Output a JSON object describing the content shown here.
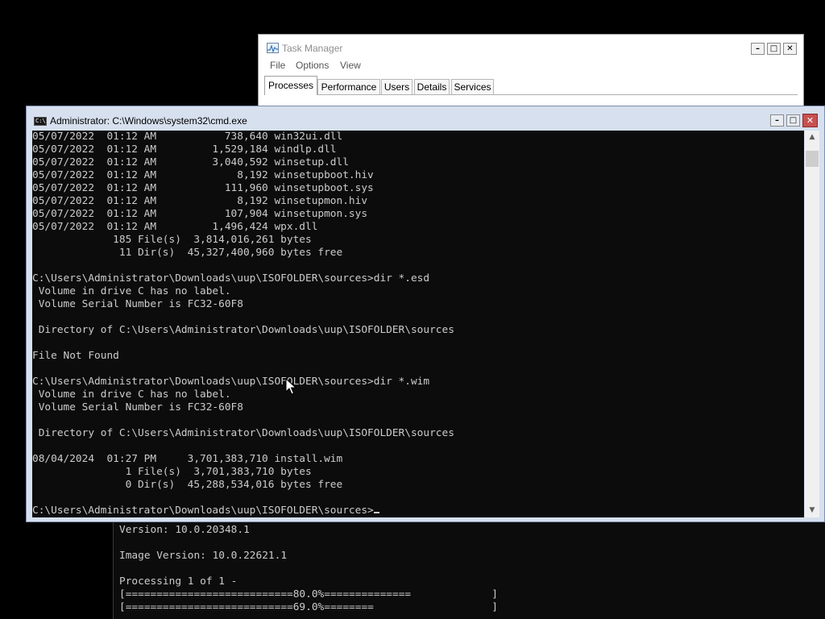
{
  "background_console": {
    "lines": [
      "Version: 10.0.20348.1",
      "",
      "Image Version: 10.0.22621.1",
      "",
      "Processing 1 of 1 -",
      "[===========================80.0%==============             ]",
      "[===========================69.0%========                   ]"
    ]
  },
  "task_manager": {
    "title": "Task Manager",
    "menu": [
      "File",
      "Options",
      "View"
    ],
    "tabs": [
      "Processes",
      "Performance",
      "Users",
      "Details",
      "Services"
    ],
    "active_tab": "Processes",
    "buttons": {
      "minimize": "–",
      "maximize": "□",
      "close": "✕"
    }
  },
  "cmd_window": {
    "title": "Administrator: C:\\Windows\\system32\\cmd.exe",
    "icon_text": "C:\\",
    "buttons": {
      "minimize": "–",
      "maximize": "□",
      "close": "✕"
    },
    "lines": [
      "05/07/2022  01:12 AM           738,640 win32ui.dll",
      "05/07/2022  01:12 AM         1,529,184 windlp.dll",
      "05/07/2022  01:12 AM         3,040,592 winsetup.dll",
      "05/07/2022  01:12 AM             8,192 winsetupboot.hiv",
      "05/07/2022  01:12 AM           111,960 winsetupboot.sys",
      "05/07/2022  01:12 AM             8,192 winsetupmon.hiv",
      "05/07/2022  01:12 AM           107,904 winsetupmon.sys",
      "05/07/2022  01:12 AM         1,496,424 wpx.dll",
      "             185 File(s)  3,814,016,261 bytes",
      "              11 Dir(s)  45,327,400,960 bytes free",
      "",
      "C:\\Users\\Administrator\\Downloads\\uup\\ISOFOLDER\\sources>dir *.esd",
      " Volume in drive C has no label.",
      " Volume Serial Number is FC32-60F8",
      "",
      " Directory of C:\\Users\\Administrator\\Downloads\\uup\\ISOFOLDER\\sources",
      "",
      "File Not Found",
      "",
      "C:\\Users\\Administrator\\Downloads\\uup\\ISOFOLDER\\sources>dir *.wim",
      " Volume in drive C has no label.",
      " Volume Serial Number is FC32-60F8",
      "",
      " Directory of C:\\Users\\Administrator\\Downloads\\uup\\ISOFOLDER\\sources",
      "",
      "08/04/2024  01:27 PM     3,701,383,710 install.wim",
      "               1 File(s)  3,701,383,710 bytes",
      "               0 Dir(s)  45,288,534,016 bytes free",
      ""
    ],
    "prompt": "C:\\Users\\Administrator\\Downloads\\uup\\ISOFOLDER\\sources>"
  },
  "colors": {
    "console_bg": "#0c0c0c",
    "console_text": "#cccccc",
    "close_button": "#c75050",
    "window_frame": "#d6e0ee"
  }
}
